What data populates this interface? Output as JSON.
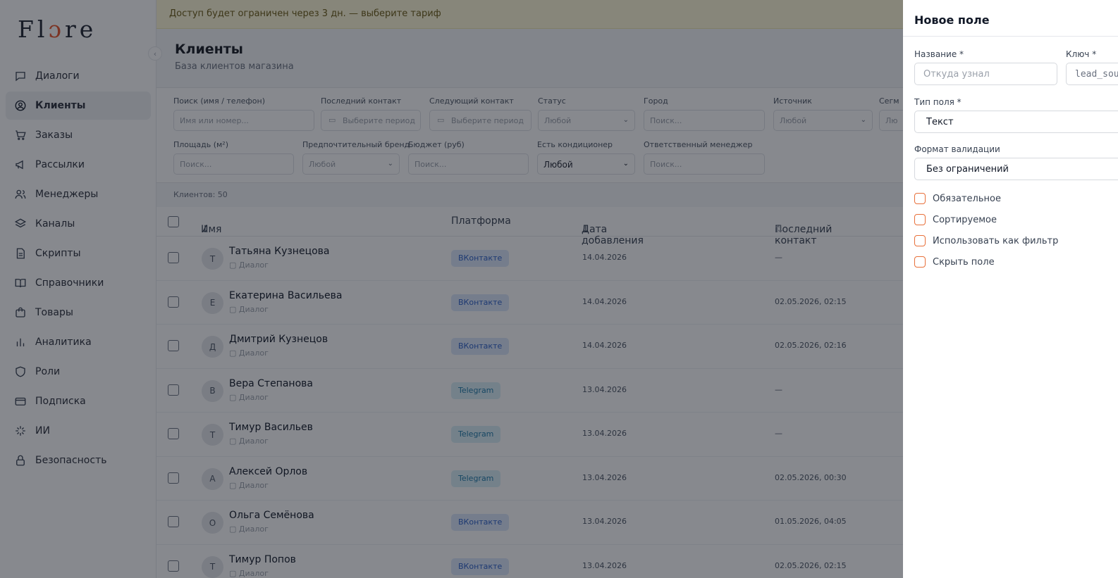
{
  "brand": {
    "logo_pre": "Fl",
    "logo_flame": "ɔ",
    "logo_post": "re"
  },
  "sidebar": {
    "items": [
      {
        "label": "Диалоги",
        "icon": "chat-icon"
      },
      {
        "label": "Клиенты",
        "icon": "user-circle-icon"
      },
      {
        "label": "Заказы",
        "icon": "cart-icon"
      },
      {
        "label": "Рассылки",
        "icon": "megaphone-icon"
      },
      {
        "label": "Менеджеры",
        "icon": "users-icon"
      },
      {
        "label": "Каналы",
        "icon": "layers-icon"
      },
      {
        "label": "Скрипты",
        "icon": "document-icon"
      },
      {
        "label": "Справочники",
        "icon": "book-icon"
      },
      {
        "label": "Товары",
        "icon": "bag-icon"
      },
      {
        "label": "Аналитика",
        "icon": "bar-chart-icon"
      },
      {
        "label": "Роли",
        "icon": "shield-icon"
      },
      {
        "label": "Подписка",
        "icon": "card-icon"
      },
      {
        "label": "ИИ",
        "icon": "sparkle-icon"
      },
      {
        "label": "Безопасность",
        "icon": "lock-icon"
      }
    ],
    "active_index": 1,
    "collapse_glyph": "‹"
  },
  "banner": {
    "text": "Доступ будет ограничен через 3 дн. — выберите тариф"
  },
  "page": {
    "title": "Клиенты",
    "subtitle": "База клиентов магазина"
  },
  "filters": {
    "search": {
      "label": "Поиск (имя / телефон)",
      "placeholder": "Имя или номер..."
    },
    "last_contact": {
      "label": "Последний контакт",
      "placeholder": "Выберите период"
    },
    "next_contact": {
      "label": "Следующий контакт",
      "placeholder": "Выберите период"
    },
    "status": {
      "label": "Статус",
      "value": "Любой"
    },
    "city": {
      "label": "Город",
      "placeholder": "Поиск..."
    },
    "source": {
      "label": "Источник",
      "value": "Любой"
    },
    "segment": {
      "label": "Сегм",
      "value": "Лю"
    },
    "area": {
      "label": "Площадь (м²)",
      "placeholder": "Поиск..."
    },
    "brand": {
      "label": "Предпочтительный бренд",
      "value": "Любой"
    },
    "budget": {
      "label": "Бюджет (руб)",
      "placeholder": "Поиск..."
    },
    "ac": {
      "label": "Есть кондиционер",
      "value": "Любой"
    },
    "manager": {
      "label": "Ответственный менеджер",
      "placeholder": "Поиск..."
    }
  },
  "count_text": "Клиентов: 50",
  "table": {
    "headers": {
      "name": "Имя",
      "platform": "Платформа",
      "date_added": "Дата добавления",
      "last_contact": "Последний контакт"
    },
    "sort_desc_glyph": "↓",
    "sort_both_glyph": "⇅",
    "sub_label": "Диалог",
    "rows": [
      {
        "initial": "Т",
        "name": "Татьяна Кузнецова",
        "platform": "ВКонтакте",
        "platform_type": "vk",
        "date": "14.04.2026",
        "last": "—"
      },
      {
        "initial": "Е",
        "name": "Екатерина Васильева",
        "platform": "ВКонтакте",
        "platform_type": "vk",
        "date": "14.04.2026",
        "last": "02.05.2026, 02:15"
      },
      {
        "initial": "Д",
        "name": "Дмитрий Кузнецов",
        "platform": "ВКонтакте",
        "platform_type": "vk",
        "date": "14.04.2026",
        "last": "02.05.2026, 02:16"
      },
      {
        "initial": "В",
        "name": "Вера Степанова",
        "platform": "Telegram",
        "platform_type": "tg",
        "date": "13.04.2026",
        "last": "—"
      },
      {
        "initial": "Т",
        "name": "Тимур Васильев",
        "platform": "Telegram",
        "platform_type": "tg",
        "date": "13.04.2026",
        "last": "—"
      },
      {
        "initial": "А",
        "name": "Алексей Орлов",
        "platform": "Telegram",
        "platform_type": "tg",
        "date": "13.04.2026",
        "last": "02.05.2026, 00:30"
      },
      {
        "initial": "О",
        "name": "Ольга Семёнова",
        "platform": "ВКонтакте",
        "platform_type": "vk",
        "date": "13.04.2026",
        "last": "01.05.2026, 04:05"
      },
      {
        "initial": "Т",
        "name": "Тимур Попов",
        "platform": "ВКонтакте",
        "platform_type": "vk",
        "date": "13.04.2026",
        "last": "02.05.2026, 02:15"
      }
    ]
  },
  "panel": {
    "title": "Новое поле",
    "name_label": "Название *",
    "name_placeholder": "Откуда узнал",
    "key_label": "Ключ *",
    "key_placeholder": "lead_sou",
    "type_label": "Тип поля *",
    "type_value": "Текст",
    "validation_label": "Формат валидации",
    "validation_value": "Без ограничений",
    "checkboxes": [
      "Обязательное",
      "Сортируемое",
      "Использовать как фильтр",
      "Скрыть поле"
    ]
  },
  "colors": {
    "accent": "#e8703a",
    "vk_badge": "#dbe7fb",
    "tg_badge": "#d8eef7",
    "banner": "#fff9d6"
  }
}
